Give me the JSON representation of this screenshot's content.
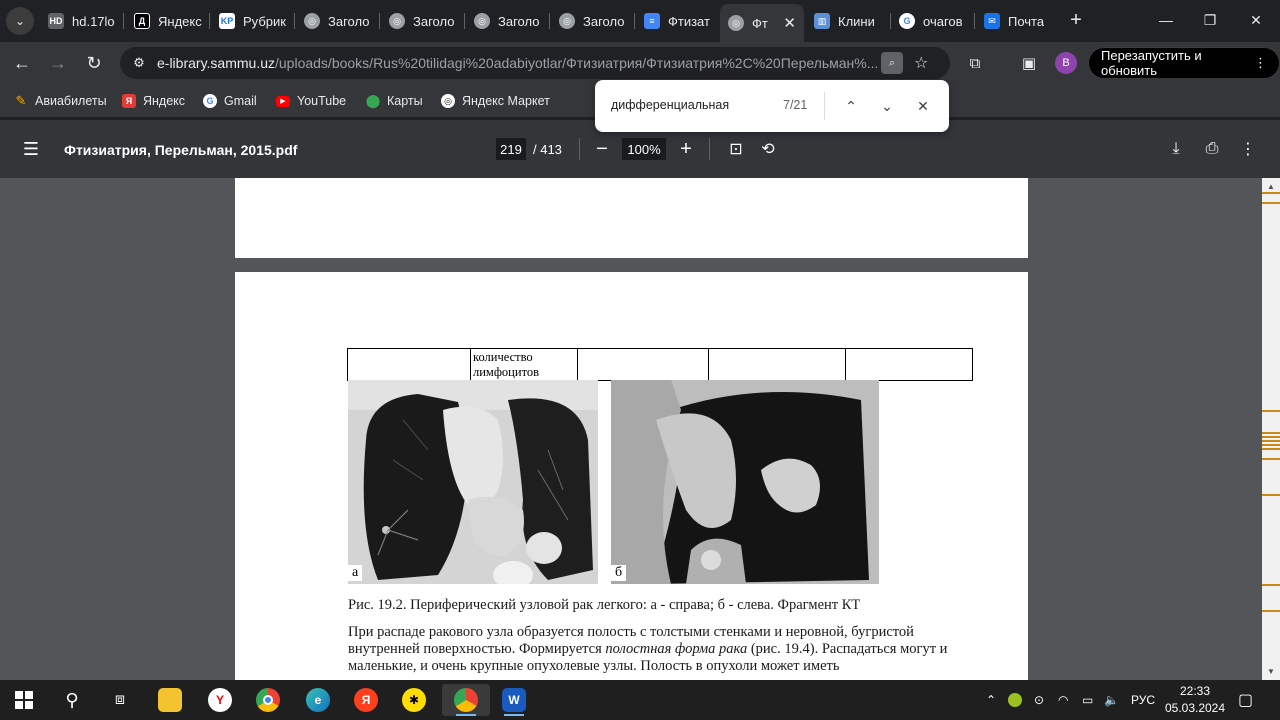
{
  "tabs": [
    {
      "title": "hd.17lo",
      "fav_color": "#5f6368",
      "fav_text": "HD"
    },
    {
      "title": "Яндекс",
      "fav_color": "#000000",
      "fav_text": "Д"
    },
    {
      "title": "Рубрик",
      "fav_color": "#1a73e8",
      "fav_text": "KP"
    },
    {
      "title": "Заголо",
      "fav_color": "#5f6368",
      "fav_text": ""
    },
    {
      "title": "Заголо",
      "fav_color": "#5f6368",
      "fav_text": ""
    },
    {
      "title": "Заголо",
      "fav_color": "#5f6368",
      "fav_text": ""
    },
    {
      "title": "Заголо",
      "fav_color": "#5f6368",
      "fav_text": ""
    },
    {
      "title": "Фтизат",
      "fav_color": "#4285f4",
      "fav_text": "≡"
    },
    {
      "title": "Фт",
      "fav_color": "#5f6368",
      "fav_text": "",
      "active": true
    },
    {
      "title": "Клини",
      "fav_color": "#5b8fd6",
      "fav_text": "▥"
    },
    {
      "title": "очагов",
      "fav_color": "#ffffff",
      "fav_text": "G"
    },
    {
      "title": "Почта",
      "fav_color": "#1a73e8",
      "fav_text": "✉"
    }
  ],
  "address": {
    "host": "e-library.sammu.uz",
    "path": "/uploads/books/Rus%20tilidagi%20adabiyotlar/Фтизиатрия/Фтизиатрия%2C%20Перельман%..."
  },
  "profile_initial": "В",
  "relaunch_label": "Перезапустить и обновить",
  "bookmarks": [
    {
      "label": "Авиабилеты",
      "color": "#f9ab00"
    },
    {
      "label": "Яндекс",
      "color": "#e53935"
    },
    {
      "label": "Gmail",
      "color": "#ffffff"
    },
    {
      "label": "YouTube",
      "color": "#ff0000"
    },
    {
      "label": "Карты",
      "color": "#34a853"
    },
    {
      "label": "Яндекс Маркет",
      "color": "#ffffff"
    }
  ],
  "find": {
    "query": "дифференциальная",
    "count": "7/21"
  },
  "pdf": {
    "filename": "Фтизиатрия, Перельман, 2015.pdf",
    "page": "219",
    "total": "/ 413",
    "zoom": "100%"
  },
  "table_cell_text": "количество лимфоцитов",
  "image_labels": {
    "a": "а",
    "b": "б"
  },
  "caption": "Рис. 19.2. Периферический узловой рак легкого: а - справа; б - слева. Фрагмент КТ",
  "paragraph": {
    "part1": "При распаде ракового узла образуется полость с толстыми стенками и неровной, бугристой внутренней поверхностью. Формируется ",
    "italic": "полостная форма рака",
    "part2": " (рис. 19.4). Распадаться могут и маленькие, и очень крупные опухолевые узлы. Полость в опухоли может иметь"
  },
  "taskbar": {
    "lang": "РУС",
    "time": "22:33",
    "date": "05.03.2024"
  }
}
